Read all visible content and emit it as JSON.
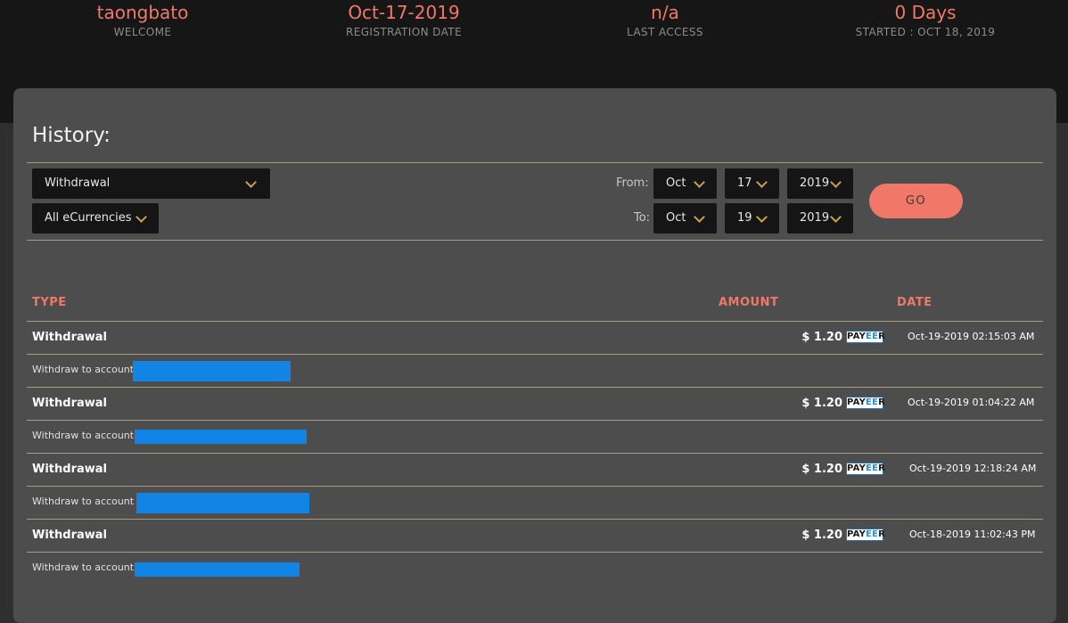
{
  "header": {
    "stats": [
      {
        "value": "taongbato",
        "label": "WELCOME"
      },
      {
        "value": "Oct-17-2019",
        "label": "REGISTRATION DATE"
      },
      {
        "value": "n/a",
        "label": "LAST ACCESS"
      },
      {
        "value": "0 Days",
        "label": "STARTED : OCT 18, 2019"
      }
    ]
  },
  "history": {
    "title": "History:",
    "type_filter": "Withdrawal",
    "currency_filter": "All eCurrencies",
    "from_label": "From:",
    "to_label": "To:",
    "from": {
      "month": "Oct",
      "day": "17",
      "year": "2019"
    },
    "to": {
      "month": "Oct",
      "day": "19",
      "year": "2019"
    },
    "go_label": "GO"
  },
  "table": {
    "headers": {
      "type": "TYPE",
      "amount": "AMOUNT",
      "date": "DATE"
    },
    "rows": [
      {
        "type": "Withdrawal",
        "amount": "$ 1.20",
        "method": "PAYEER",
        "date": "Oct-19-2019 02:15:03 AM",
        "detail": "Withdraw to account"
      },
      {
        "type": "Withdrawal",
        "amount": "$ 1.20",
        "method": "PAYEER",
        "date": "Oct-19-2019 01:04:22 AM",
        "detail": "Withdraw to account"
      },
      {
        "type": "Withdrawal",
        "amount": "$ 1.20",
        "method": "PAYEER",
        "date": "Oct-19-2019 12:18:24 AM",
        "detail": "Withdraw to account"
      },
      {
        "type": "Withdrawal",
        "amount": "$ 1.20",
        "method": "PAYEER",
        "date": "Oct-18-2019 11:02:43 PM",
        "detail": "Withdraw to account"
      }
    ]
  },
  "colors": {
    "accent": "#f07868",
    "redaction": "#1184e6",
    "panel": "#4c4d4c",
    "header_bg": "#161616"
  }
}
